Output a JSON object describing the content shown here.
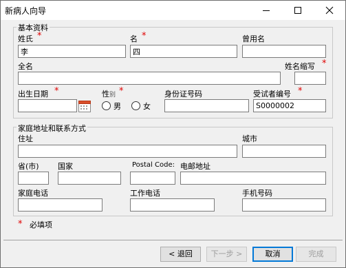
{
  "window": {
    "title": "新病人向导"
  },
  "basic": {
    "group_title": "基本资料",
    "surname_label": "姓氏",
    "surname_value": "李",
    "given_label": "名",
    "given_value": "四",
    "former_label": "曾用名",
    "former_value": "",
    "fullname_label": "全名",
    "fullname_value": "",
    "abbr_label": "姓名缩写",
    "abbr_value": "",
    "dob_label": "出生日期",
    "dob_value": "",
    "gender_label": "性",
    "gender_label_small": "别",
    "gender_male": "男",
    "gender_female": "女",
    "idcard_label": "身份证号码",
    "idcard_value": "",
    "subject_label": "受试者编号",
    "subject_value": "S0000002"
  },
  "address": {
    "group_title": "家庭地址和联系方式",
    "street_label": "住址",
    "street_value": "",
    "city_label": "城市",
    "city_value": "",
    "province_label": "省(市)",
    "province_value": "",
    "country_label": "国家",
    "country_value": "",
    "postal_label": "Postal Code:",
    "postal_value": "",
    "email_label": "电邮地址",
    "email_value": "",
    "home_phone_label": "家庭电话",
    "home_phone_value": "",
    "work_phone_label": "工作电话",
    "work_phone_value": "",
    "mobile_label": "手机号码",
    "mobile_value": ""
  },
  "legend": {
    "required_label": "必填项"
  },
  "buttons": {
    "back": "< 退回",
    "next": "下一步 >",
    "cancel": "取消",
    "finish": "完成"
  },
  "colors": {
    "required": "#e00000",
    "default_button_border": "#0078d7"
  },
  "icons": {
    "date_picker": "calendar-icon",
    "minimize": "minimize-icon",
    "maximize": "maximize-icon",
    "close": "close-icon"
  }
}
